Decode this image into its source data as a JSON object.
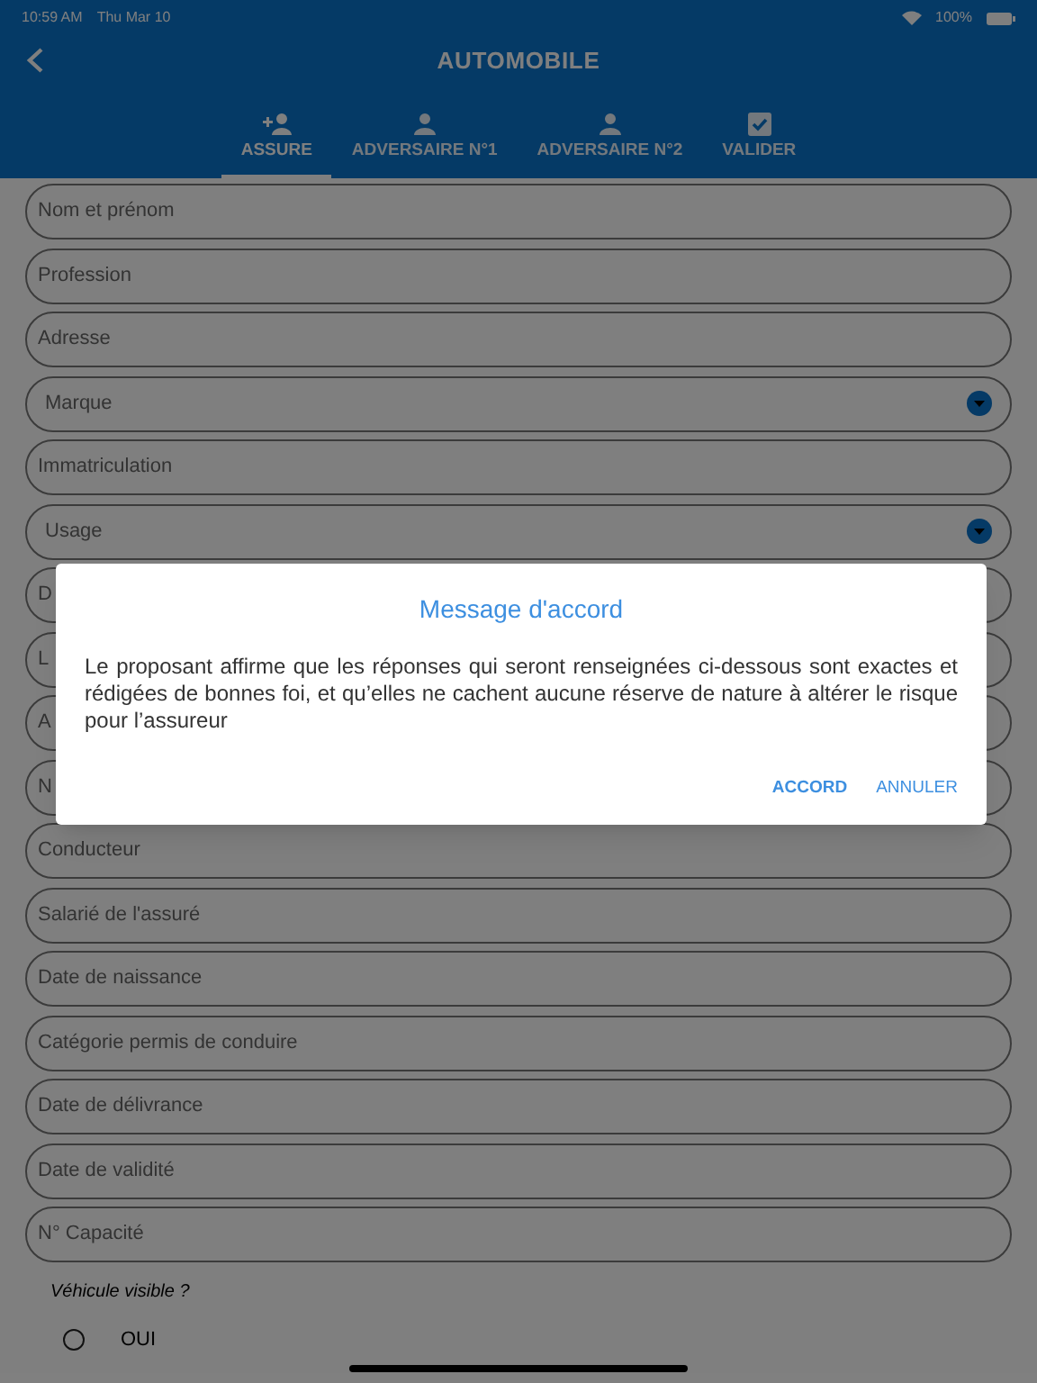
{
  "status_bar": {
    "time": "10:59 AM",
    "date": "Thu Mar 10",
    "battery": "100%"
  },
  "header": {
    "title": "AUTOMOBILE"
  },
  "tabs": [
    {
      "label": "ASSURE",
      "selected": true
    },
    {
      "label": "ADVERSAIRE N°1",
      "selected": false
    },
    {
      "label": "ADVERSAIRE N°2",
      "selected": false
    },
    {
      "label": "VALIDER",
      "selected": false
    }
  ],
  "fields": [
    {
      "kind": "text",
      "placeholder": "Nom et prénom"
    },
    {
      "kind": "text",
      "placeholder": "Profession"
    },
    {
      "kind": "text",
      "placeholder": "Adresse"
    },
    {
      "kind": "dropdown",
      "placeholder": "Marque"
    },
    {
      "kind": "text",
      "placeholder": "Immatriculation"
    },
    {
      "kind": "dropdown",
      "placeholder": "Usage"
    },
    {
      "kind": "text",
      "placeholder": "D"
    },
    {
      "kind": "text",
      "placeholder": "L"
    },
    {
      "kind": "text",
      "placeholder": "A"
    },
    {
      "kind": "text",
      "placeholder": "N"
    },
    {
      "kind": "text",
      "placeholder": "Conducteur"
    },
    {
      "kind": "text",
      "placeholder": "Salarié de l'assuré"
    },
    {
      "kind": "text",
      "placeholder": "Date de naissance"
    },
    {
      "kind": "text",
      "placeholder": "Catégorie permis de conduire"
    },
    {
      "kind": "text",
      "placeholder": "Date de délivrance"
    },
    {
      "kind": "text",
      "placeholder": "Date de validité"
    },
    {
      "kind": "text",
      "placeholder": "N° Capacité"
    }
  ],
  "question": {
    "label": "Véhicule visible ?",
    "options": [
      {
        "label": "OUI",
        "selected": false
      }
    ]
  },
  "dialog": {
    "title": "Message d'accord",
    "message": "Le proposant affirme que les réponses qui seront renseignées ci-dessous sont exactes et rédigées de bonnes foi, et qu’elles ne cachent aucune réserve de nature à altérer le risque pour l’assureur",
    "buttons": [
      {
        "label": "ACCORD",
        "primary": true
      },
      {
        "label": "ANNULER",
        "primary": false
      }
    ]
  }
}
